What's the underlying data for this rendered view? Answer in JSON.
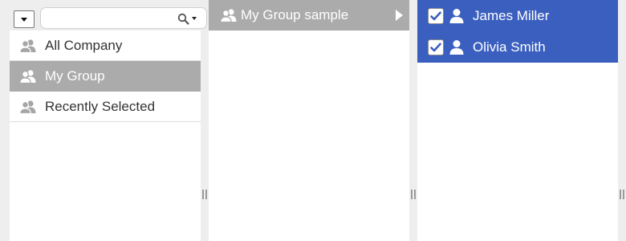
{
  "search": {
    "value": "",
    "placeholder": ""
  },
  "groups": [
    {
      "label": "All Company",
      "icon": "group-icon",
      "selected": false
    },
    {
      "label": "My Group",
      "icon": "group-icon",
      "selected": true
    },
    {
      "label": "Recently Selected",
      "icon": "group-icon",
      "selected": false
    }
  ],
  "subgroups": [
    {
      "label": "My Group sample",
      "icon": "group-icon",
      "selected": true
    }
  ],
  "users": [
    {
      "name": "James Miller",
      "icon": "user-icon",
      "checked": true
    },
    {
      "name": "Olivia Smith",
      "icon": "user-icon",
      "checked": true
    }
  ],
  "colors": {
    "selected_gray": "#ababab",
    "selected_blue": "#3a5fbf",
    "icon_gray": "#a6a6a6"
  }
}
